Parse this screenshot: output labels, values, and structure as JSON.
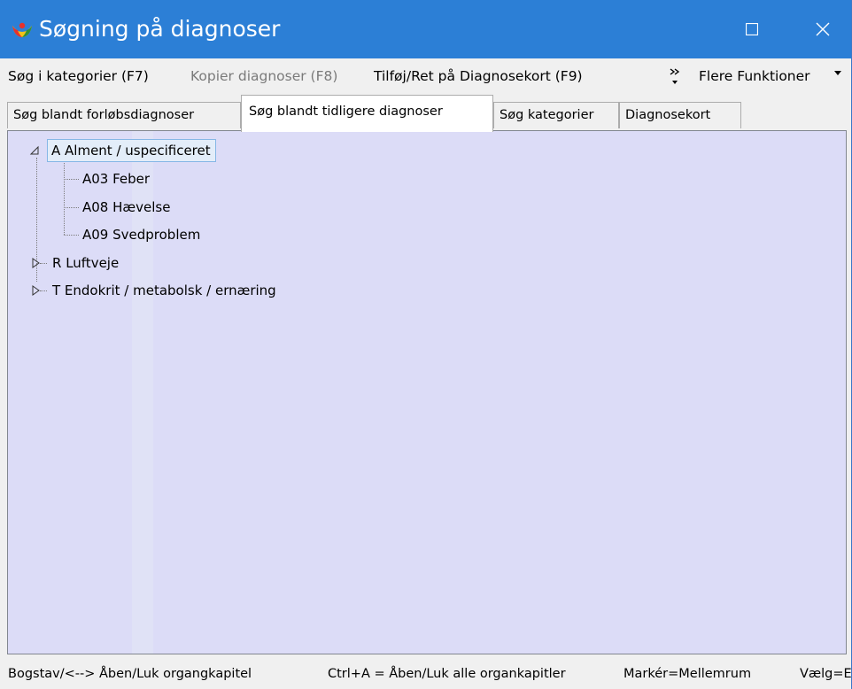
{
  "window": {
    "title": "Søgning på diagnoser",
    "accent_color": "#2c7fd6",
    "icons": {
      "app": "app-logo-icon",
      "maximize": "maximize-icon",
      "close": "close-icon"
    }
  },
  "toolbar": {
    "search_categories_label": "Søg i kategorier (F7)",
    "copy_diagnoses_label": "Kopier diagnoser (F8)",
    "add_edit_label": "Tilføj/Ret på Diagnosekort (F9)",
    "more_functions_label": "Flere Funktioner",
    "overflow_icon": "chevron-double-right-icon",
    "more_dropdown_icon": "caret-down-icon"
  },
  "tabs": [
    {
      "label": "Søg blandt forløbsdiagnoser",
      "active": false
    },
    {
      "label": "Søg blandt tidligere diagnoser",
      "active": true
    },
    {
      "label": "Søg kategorier",
      "active": false
    },
    {
      "label": "Diagnosekort",
      "active": false
    }
  ],
  "tree": {
    "background_color": "#dcdcf7",
    "nodes": [
      {
        "label": "A Alment / uspecificeret",
        "expanded": true,
        "selected": true,
        "children": [
          {
            "label": "A03 Feber"
          },
          {
            "label": "A08 Hævelse"
          },
          {
            "label": "A09 Svedproblem"
          }
        ]
      },
      {
        "label": "R Luftveje",
        "expanded": false
      },
      {
        "label": "T Endokrit / metabolsk / ernæring",
        "expanded": false
      }
    ]
  },
  "statusbar": {
    "items": [
      "Bogstav/<--> Åben/Luk organgkapitel",
      "Ctrl+A = Åben/Luk alle organkapitler",
      "Markér=Mellemrum",
      "Vælg=E"
    ]
  }
}
